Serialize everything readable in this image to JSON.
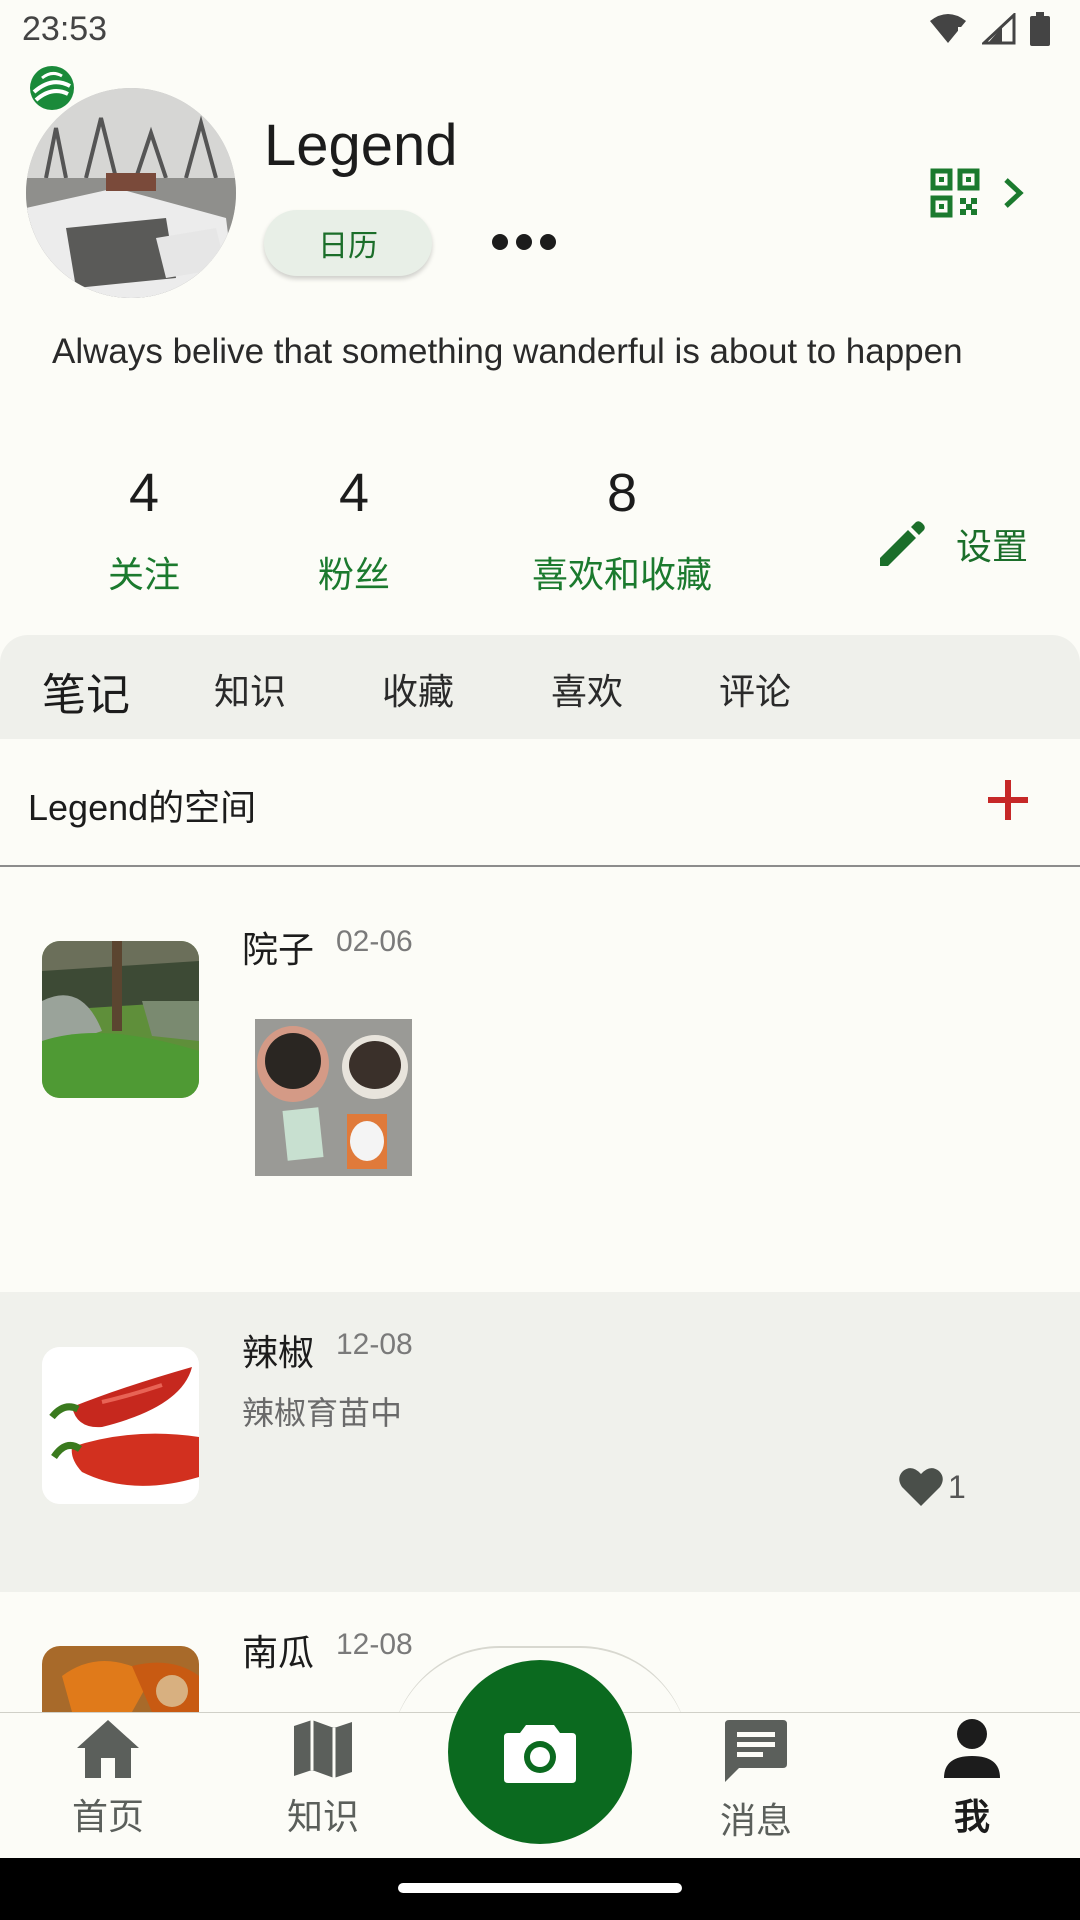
{
  "status_bar": {
    "time": "23:53"
  },
  "profile": {
    "username": "Legend",
    "calendar_label": "日历",
    "bio": "Always belive that something wanderful is about to happen",
    "stats": [
      {
        "value": "4",
        "label": "关注"
      },
      {
        "value": "4",
        "label": "粉丝"
      },
      {
        "value": "8",
        "label": "喜欢和收藏"
      }
    ],
    "settings_label": "设置"
  },
  "tabs": [
    "笔记",
    "知识",
    "收藏",
    "喜欢",
    "评论"
  ],
  "active_tab": "笔记",
  "space": {
    "title": "Legend的空间"
  },
  "notes": [
    {
      "title": "院子",
      "date": "02-06",
      "body": "",
      "likes": ""
    },
    {
      "title": "辣椒",
      "date": "12-08",
      "body": "辣椒育苗中",
      "likes": "1"
    },
    {
      "title": "南瓜",
      "date": "12-08",
      "body": "",
      "likes": ""
    }
  ],
  "bottom_nav": [
    {
      "label": "首页",
      "icon": "home-icon"
    },
    {
      "label": "知识",
      "icon": "map-icon"
    },
    {
      "label": "",
      "icon": "camera-icon"
    },
    {
      "label": "消息",
      "icon": "message-icon"
    },
    {
      "label": "我",
      "icon": "person-icon"
    }
  ],
  "colors": {
    "accent_green": "#1b7a2e",
    "fab_green": "#0b6a1f",
    "add_red": "#c62828",
    "background": "#fcfcf7"
  }
}
